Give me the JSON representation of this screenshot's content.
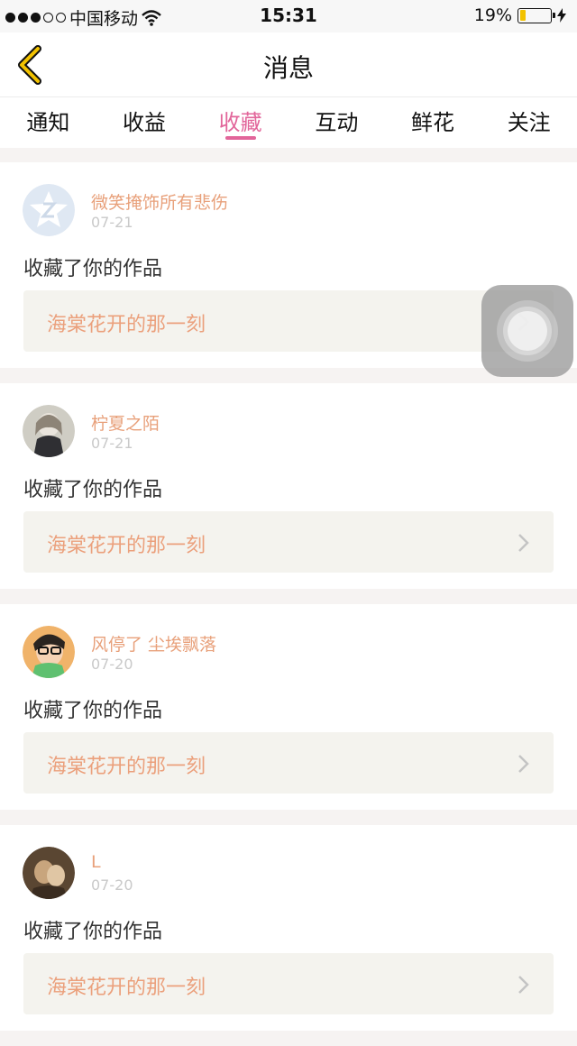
{
  "status_bar": {
    "carrier": "中国移动",
    "time": "15:31",
    "battery_percent": "19%",
    "battery_level": 0.19
  },
  "navbar": {
    "title": "消息",
    "back_icon": "chevron-left-icon"
  },
  "tabs": [
    {
      "label": "通知",
      "active": false
    },
    {
      "label": "收益",
      "active": false
    },
    {
      "label": "收藏",
      "active": true
    },
    {
      "label": "互动",
      "active": false
    },
    {
      "label": "鲜花",
      "active": false
    },
    {
      "label": "关注",
      "active": false
    }
  ],
  "items": [
    {
      "user": "微笑掩饰所有悲伤",
      "date": "07-21",
      "action": "收藏了你的作品",
      "work": "海棠花开的那一刻"
    },
    {
      "user": "柠夏之陌",
      "date": "07-21",
      "action": "收藏了你的作品",
      "work": "海棠花开的那一刻"
    },
    {
      "user": "风停了 尘埃飘落",
      "date": "07-20",
      "action": "收藏了你的作品",
      "work": "海棠花开的那一刻"
    },
    {
      "user": "L",
      "date": "07-20",
      "action": "收藏了你的作品",
      "work": "海棠花开的那一刻"
    }
  ],
  "colors": {
    "accent": "#e2659a",
    "username": "#e8a07a",
    "work_title": "#eba07c",
    "back_arrow": "#f2c200"
  }
}
